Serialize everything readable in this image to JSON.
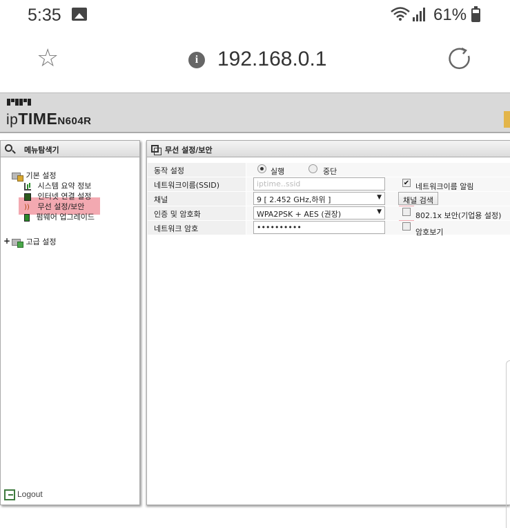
{
  "status_bar": {
    "time": "5:35",
    "battery": "61%"
  },
  "browser": {
    "url": "192.168.0.1"
  },
  "router": {
    "logo_prefix": "ip",
    "logo_brand": "TIME",
    "logo_model": "N604R"
  },
  "left_panel": {
    "title": "메뉴탐색기",
    "basic_settings": "기본 설정",
    "items": [
      {
        "label": "시스템 요약 정보"
      },
      {
        "label": "인터넷 연결 설정"
      },
      {
        "label": "무선 설정/보안"
      },
      {
        "label": "펌웨어 업그레이드"
      }
    ],
    "advanced_settings": "고급 설정",
    "logout": "Logout"
  },
  "right_panel": {
    "title": "무선 설정/보안",
    "operation": {
      "label": "동작 설정",
      "on": "실행",
      "off": "중단"
    },
    "ssid": {
      "label": "네트워크이름(SSID)",
      "value": "iptime..ssid",
      "broadcast_label": "네트워크이름 알림"
    },
    "channel": {
      "label": "채널",
      "value": "9 [ 2.452 GHz,하위 ]",
      "search_button": "채널 검색"
    },
    "auth": {
      "label": "인증 및 암호화",
      "value": "WPA2PSK + AES (권장)",
      "enterprise_label": "802.1x 보안(기업용 설정)"
    },
    "password": {
      "label": "네트워크 암호",
      "value": "••••••••••",
      "show_label": "암호보기"
    }
  }
}
